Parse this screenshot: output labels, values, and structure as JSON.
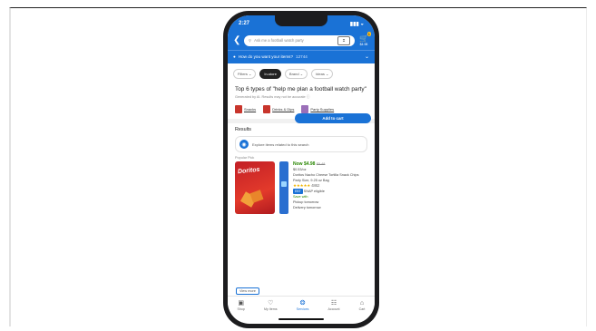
{
  "status": {
    "time": "2:27",
    "signal": "▮▮▮ ◒",
    "battery": "▭"
  },
  "header": {
    "search_placeholder": "Ask me a football watch party",
    "scan_label": "⌗",
    "cart_count": "1",
    "cart_price": "$4.98"
  },
  "delivery": {
    "text": "How do you want your items?",
    "zip": "12744"
  },
  "filters": [
    {
      "label": "Filters ⌄",
      "active": false
    },
    {
      "label": "In-store",
      "active": true
    },
    {
      "label": "Brand ⌄",
      "active": false
    },
    {
      "label": "Ideas ⌄",
      "active": false
    }
  ],
  "top6": {
    "title": "Top 6 types of \"help me plan a football watch party\"",
    "subtitle": "Generated by AI. Results may not be accurate ⓘ"
  },
  "types": [
    {
      "label": "Snacks"
    },
    {
      "label": "Drinks & Dips"
    },
    {
      "label": "Party Supplies"
    }
  ],
  "results_heading": "Results",
  "explore": "Explore items related to this search",
  "product": {
    "badge": "Popular Pick",
    "price": "Now $4.98",
    "was": "$5.48",
    "unit": "$0.53/oz",
    "name": "Doritos Nacho Cheese Tortilla Snack Chips Party Size, 9.25 oz Bag",
    "stars": "★★★★★",
    "reviews": "4862",
    "tag": "EBT",
    "tag_text": "SNAP eligible",
    "ship": "Save with",
    "pickup": "Pickup tomorrow",
    "delivery": "Delivery tomorrow",
    "add_label": "Add to cart",
    "logo": "Doritos"
  },
  "view_more": "View more",
  "tabs": [
    {
      "label": "Shop",
      "icon": "▣"
    },
    {
      "label": "My Items",
      "icon": "♡"
    },
    {
      "label": "Services",
      "icon": "❂"
    },
    {
      "label": "Account",
      "icon": "☷"
    },
    {
      "label": "Cart",
      "icon": "⌂"
    }
  ],
  "colors": {
    "brand": "#1a72d6",
    "accent": "#ffc220",
    "price": "#2a8703"
  }
}
